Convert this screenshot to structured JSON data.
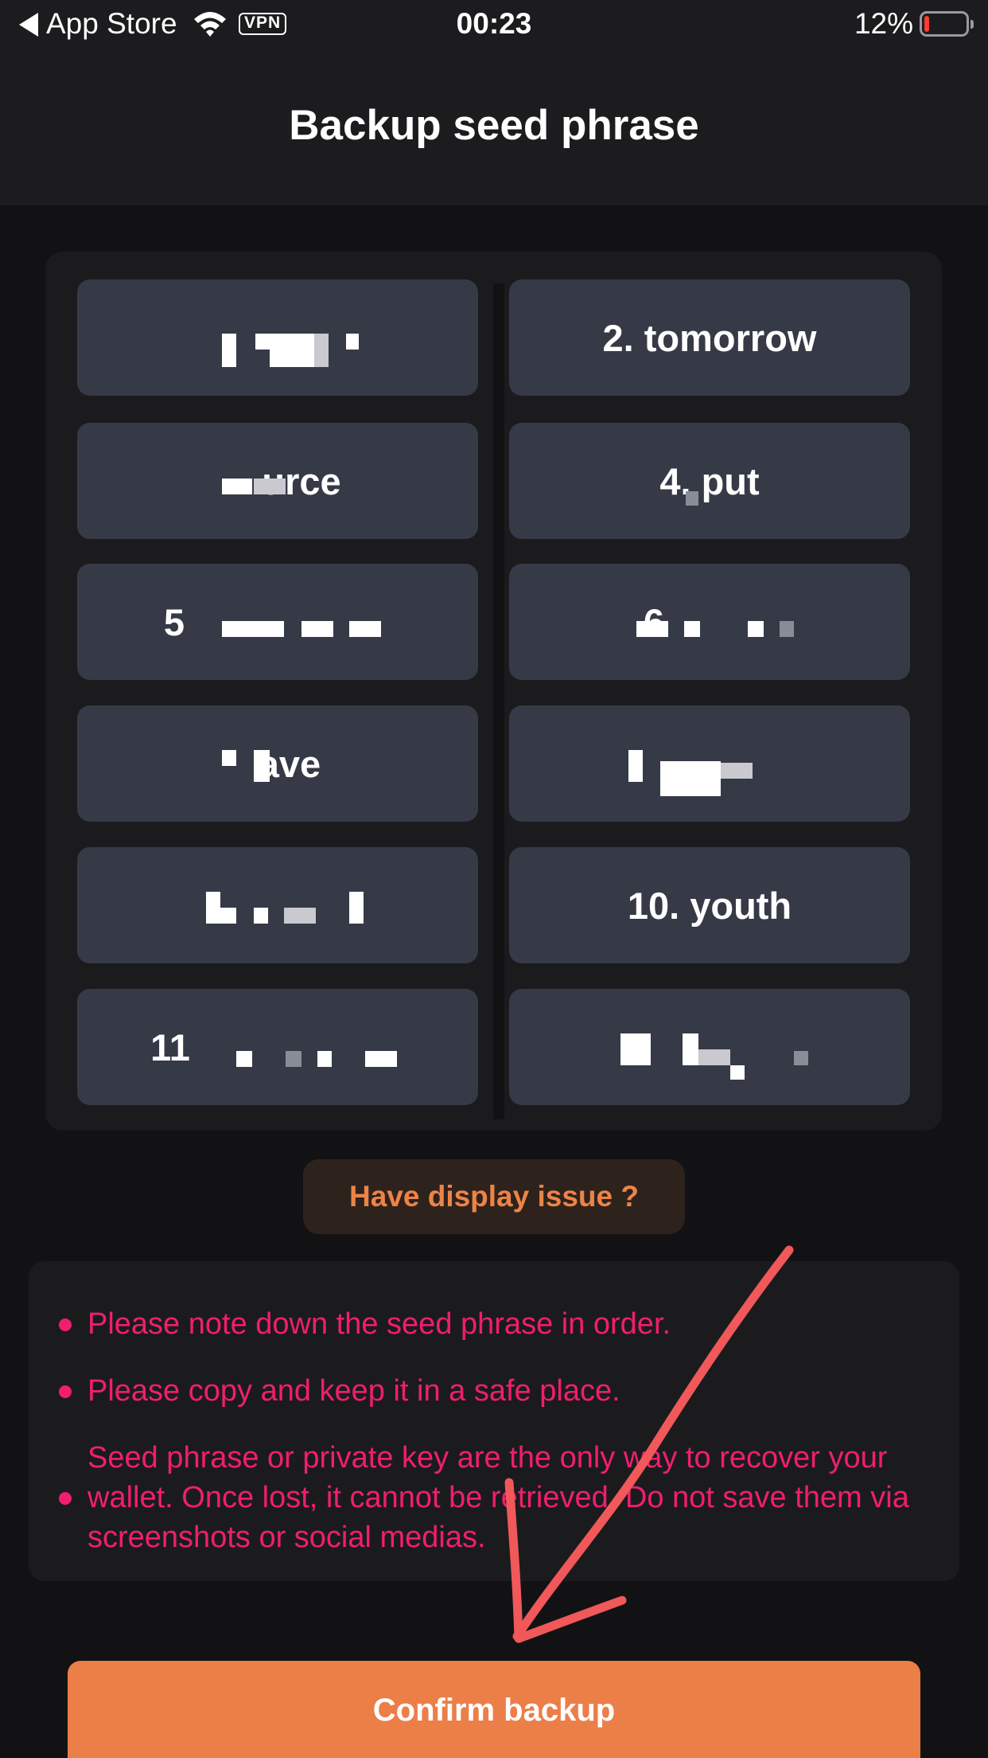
{
  "status_bar": {
    "carrier": "App Store",
    "vpn": "VPN",
    "time": "00:23",
    "battery_percent": "12%",
    "battery_level": 0.12
  },
  "header": {
    "title": "Backup seed phrase"
  },
  "seed_words": [
    {
      "text": ""
    },
    {
      "text": "2. tomorrow"
    },
    {
      "text": "urce"
    },
    {
      "text": "4. put"
    },
    {
      "text": "5"
    },
    {
      "text": "6"
    },
    {
      "text": "ave"
    },
    {
      "text": ""
    },
    {
      "text": ""
    },
    {
      "text": "10. youth"
    },
    {
      "text": "11"
    },
    {
      "text": ""
    }
  ],
  "display_issue": {
    "label": "Have display issue ?"
  },
  "notes": [
    "Please note down the seed phrase in order.",
    "Please copy and keep it in a safe place.",
    "Seed phrase or private key are the only way to recover your wallet. Once lost, it cannot be retrieved. Do not save them via screenshots or social medias."
  ],
  "confirm": {
    "label": "Confirm backup"
  },
  "colors": {
    "background": "#121214",
    "cell": "#363a47",
    "accent_orange": "#ec7e48",
    "warning_pink": "#f01e6e",
    "arrow_red": "#f0585a"
  },
  "icons": [
    "back-arrow-icon",
    "wifi-icon",
    "battery-icon"
  ]
}
